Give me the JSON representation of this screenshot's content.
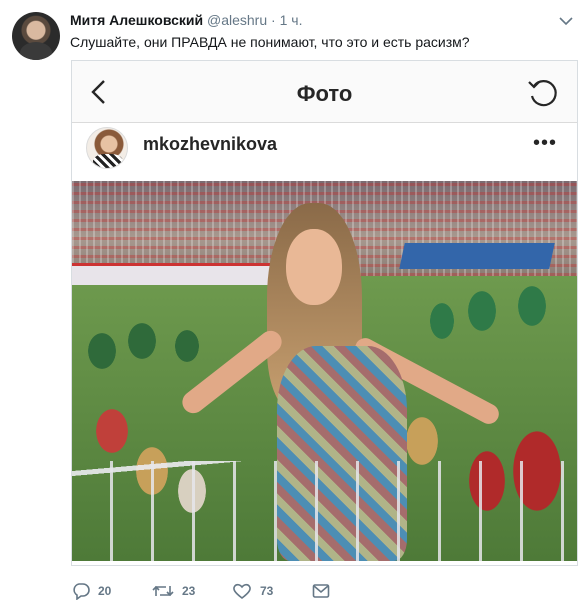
{
  "tweet": {
    "author_name": "Митя Алешковский",
    "handle": "@aleshru",
    "separator": "·",
    "time": "1 ч.",
    "text": "Слушайте, они ПРАВДА не понимают, что это и есть расизм?"
  },
  "embedded_screenshot": {
    "title": "Фото",
    "back_icon": "chevron-left-icon",
    "refresh_icon": "refresh-icon",
    "username": "mkozhevnikova",
    "more_icon": "more-dots-icon",
    "more_label": "•••"
  },
  "actions": {
    "reply_count": "20",
    "retweet_count": "23",
    "like_count": "73",
    "icons": [
      "reply-icon",
      "retweet-icon",
      "like-icon",
      "message-icon"
    ]
  },
  "colors": {
    "text_primary": "#14171a",
    "text_secondary": "#657786",
    "border": "#d8dde1"
  }
}
